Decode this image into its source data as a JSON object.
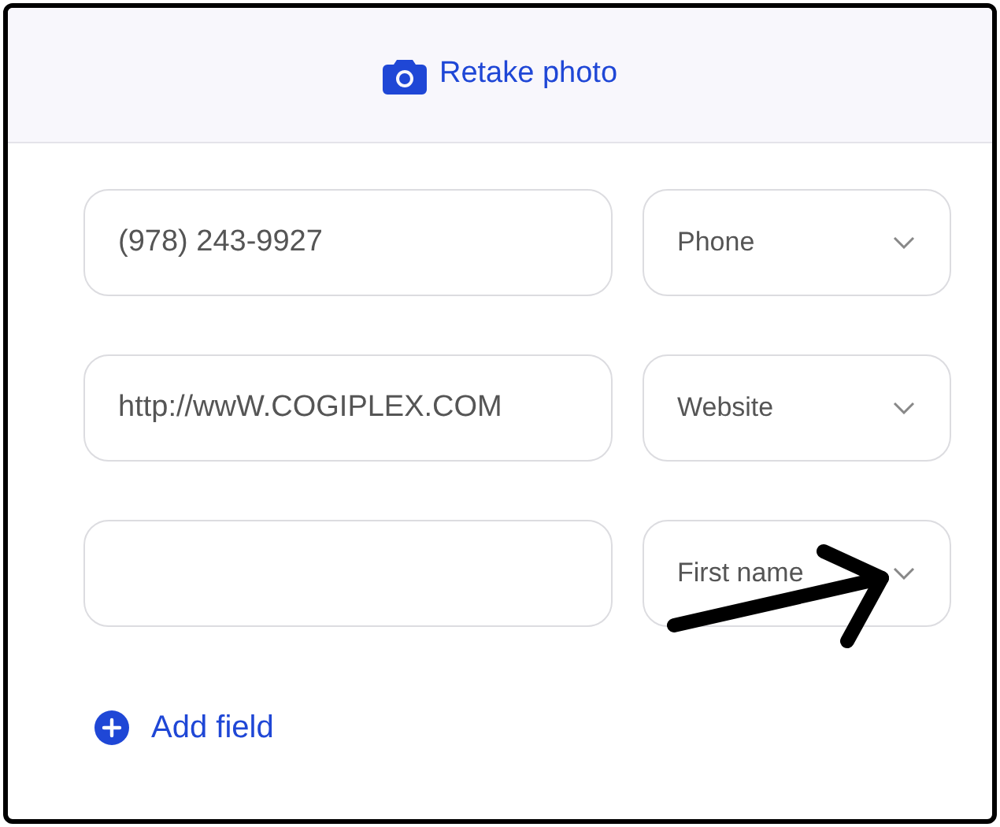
{
  "header": {
    "button": "Retake photo"
  },
  "fields": [
    {
      "value": "(978) 243-9927",
      "type": "Phone"
    },
    {
      "value": "http://wwW.COGIPLEX.COM",
      "type": "Website"
    },
    {
      "type": "First name"
    }
  ],
  "add_button": "Add field"
}
